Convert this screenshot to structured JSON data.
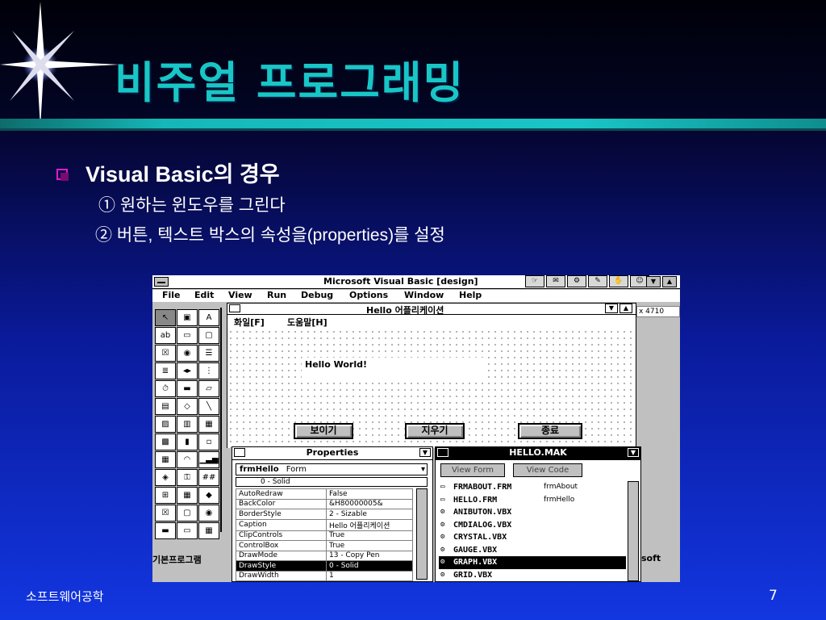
{
  "slide": {
    "title": "비주얼 프로그래밍",
    "bullet": "Visual Basic의 경우",
    "sub1": "① 원하는 윈도우를 그린다",
    "sub2": "② 버튼, 텍스트 박스의 속성을(properties)를 설정",
    "footer_left": "소프트웨어공학",
    "page_number": "7"
  },
  "vb": {
    "title": "Microsoft Visual Basic [design]",
    "menu": [
      "File",
      "Edit",
      "View",
      "Run",
      "Debug",
      "Options",
      "Window",
      "Help"
    ],
    "coord_readout": "x 4710",
    "form": {
      "title": "Hello 어플리케이션",
      "menu": [
        "화일[F]",
        "도움말[H]"
      ],
      "label": "Hello World!",
      "buttons": [
        "보이기",
        "지우기",
        "종료"
      ]
    },
    "properties": {
      "title": "Properties",
      "object": "frmHello",
      "object_type": "Form",
      "value_edit": "0 - Solid",
      "rows": [
        [
          "AutoRedraw",
          "False"
        ],
        [
          "BackColor",
          "&H80000005&"
        ],
        [
          "BorderStyle",
          "2 - Sizable"
        ],
        [
          "Caption",
          "Hello 어플리케이션"
        ],
        [
          "ClipControls",
          "True"
        ],
        [
          "ControlBox",
          "True"
        ],
        [
          "DrawMode",
          "13 - Copy Pen"
        ],
        [
          "DrawStyle",
          "0 - Solid"
        ],
        [
          "DrawWidth",
          "1"
        ]
      ],
      "selected_row": 7
    },
    "project": {
      "title": "HELLO.MAK",
      "view_form": "View Form",
      "view_code": "View Code",
      "files": [
        [
          "FRMABOUT.FRM",
          "frmAbout"
        ],
        [
          "HELLO.FRM",
          "frmHello"
        ],
        [
          "ANIBUTON.VBX",
          ""
        ],
        [
          "CMDIALOG.VBX",
          ""
        ],
        [
          "CRYSTAL.VBX",
          ""
        ],
        [
          "GAUGE.VBX",
          ""
        ],
        [
          "GRAPH.VBX",
          ""
        ],
        [
          "GRID.VBX",
          ""
        ]
      ],
      "selected_file": 6
    },
    "taskbar_text": "기본프로그램",
    "right_edge_text": "soft"
  }
}
